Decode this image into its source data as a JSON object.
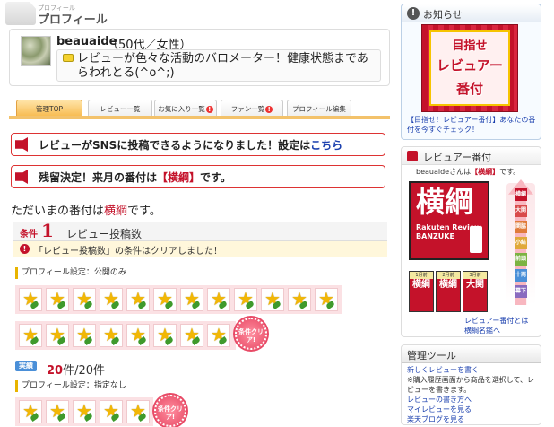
{
  "header": {
    "small_text": "プロフィール",
    "title": "プロフィール"
  },
  "profile": {
    "username": "beauaide",
    "age_gender": "（50代／女性）",
    "bio": "レビューが色々な活動のバロメーター！健康状態まであらわれとる(^o^;)"
  },
  "tabs": [
    {
      "label": "管理TOP",
      "warn": false
    },
    {
      "label": "レビュー一覧",
      "warn": false
    },
    {
      "label": "お気に入り一覧",
      "warn": true
    },
    {
      "label": "ファン一覧",
      "warn": true
    },
    {
      "label": "プロフィール編集",
      "warn": false
    }
  ],
  "notices": {
    "sns": {
      "text": "レビューがSNSに投稿できるようになりました！設定は",
      "link": "こちら"
    },
    "rank": {
      "prefix": "残留決定！来月の番付は",
      "rank": "【横綱】",
      "suffix": "です。"
    }
  },
  "current_rank": {
    "prefix": "ただいまの番付は",
    "rank": "横綱",
    "suffix": "です。"
  },
  "condition": {
    "label": "条件",
    "number": "1",
    "name": "レビュー投稿数",
    "clear_message": "「レビュー投稿数」の条件はクリアしました！",
    "setting_public": "プロフィール設定：公開のみ",
    "setting_none": "プロフィール設定：指定なし",
    "clear_badge": "条件クリア!",
    "achievement_label": "実績",
    "achievement_count": "20",
    "achievement_total": "件/20件"
  },
  "news": {
    "title": "お知らせ",
    "banner_lines": [
      "目指せ",
      "レビュアー",
      "番付"
    ],
    "caption": "【目指せ！レビュアー番付】あなたの番付を今すぐチェック！"
  },
  "banzuke": {
    "title": "レビュアー番付",
    "user_line_prefix": "beauaideさんは",
    "user_rank": "【横綱】",
    "user_line_suffix": "です。",
    "big_kanji": "横綱",
    "brand": "Rakuten Review BANZUKE",
    "monthly": [
      {
        "month": "1月前",
        "rank": "横綱"
      },
      {
        "month": "2月前",
        "rank": "横綱"
      },
      {
        "month": "3月前",
        "rank": "大関"
      }
    ],
    "ladder": [
      "横綱",
      "大関",
      "関脇",
      "小結",
      "前頭",
      "十両",
      "幕下"
    ],
    "links": [
      "レビュアー番付とは",
      "横綱名鑑へ"
    ]
  },
  "tools": {
    "title": "管理ツール",
    "items": [
      {
        "text": "新しくレビューを書く",
        "link": true
      },
      {
        "text": "※購入履歴画面から商品を選択して、レビューを書きます。",
        "link": false
      },
      {
        "text": "レビューの書き方へ",
        "link": true
      },
      {
        "text": "マイレビューを見る",
        "link": true
      },
      {
        "text": "楽天ブログを見る",
        "link": true
      }
    ]
  },
  "colors": {
    "accent_red": "#c4122a",
    "link_blue": "#1a3fae",
    "tab_active": "#f7b84a"
  }
}
